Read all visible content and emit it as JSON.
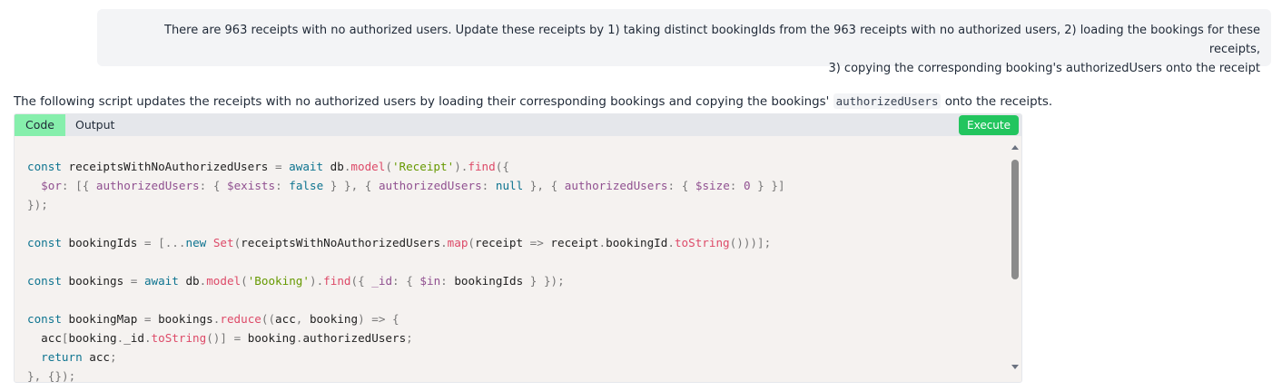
{
  "user_message": {
    "line1": "There are 963 receipts with no authorized users. Update these receipts by 1) taking distinct bookingIds from the 963 receipts with no authorized users, 2) loading the bookings for these receipts,",
    "line2": "3) copying the corresponding booking's authorizedUsers onto the receipt"
  },
  "assistant": {
    "intro_before": "The following script updates the receipts with no authorized users by loading their corresponding bookings and copying the bookings' ",
    "intro_code": "authorizedUsers",
    "intro_after": " onto the receipts."
  },
  "code_panel": {
    "tabs": [
      "Code",
      "Output"
    ],
    "active_tab": "Code",
    "execute_label": "Execute",
    "code_lines": [
      "const receiptsWithNoAuthorizedUsers = await db.model('Receipt').find({",
      "  $or: [{ authorizedUsers: { $exists: false } }, { authorizedUsers: null }, { authorizedUsers: { $size: 0 } }]",
      "});",
      "",
      "const bookingIds = [...new Set(receiptsWithNoAuthorizedUsers.map(receipt => receipt.bookingId.toString()))];",
      "",
      "const bookings = await db.model('Booking').find({ _id: { $in: bookingIds } });",
      "",
      "const bookingMap = bookings.reduce((acc, booking) => {",
      "  acc[booking._id.toString()] = booking.authorizedUsers;",
      "  return acc;",
      "}, {});"
    ]
  },
  "colors": {
    "tab_active": "#86efac",
    "execute_button": "#22c55e",
    "code_background": "#f5f2f0",
    "keyword": "#0e7490",
    "function": "#dd4a68",
    "string": "#669900",
    "property": "#905090"
  },
  "icons": [
    "scroll-up-arrow-icon",
    "scroll-down-arrow-icon"
  ]
}
